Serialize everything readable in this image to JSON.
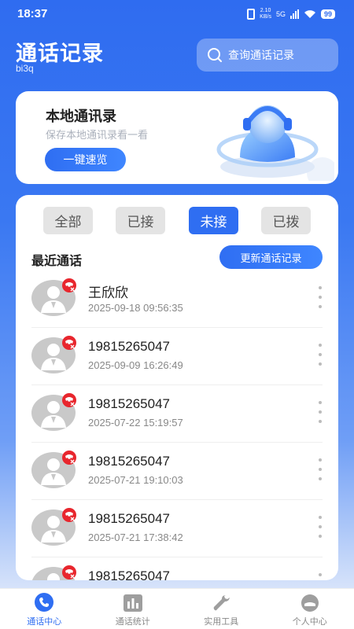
{
  "status_bar": {
    "time": "18:37",
    "speed_top": "2.10",
    "speed_bottom": "KB/s",
    "network": "5G",
    "battery": "99"
  },
  "header": {
    "title": "通话记录",
    "subtitle": "bi3q",
    "search_placeholder": "查询通话记录"
  },
  "local_card": {
    "title": "本地通讯录",
    "description": "保存本地通讯录看一看",
    "button": "一键速览"
  },
  "tabs": [
    {
      "label": "全部",
      "active": false
    },
    {
      "label": "已接",
      "active": false
    },
    {
      "label": "未接",
      "active": true
    },
    {
      "label": "已拨",
      "active": false
    }
  ],
  "recent": {
    "title": "最近通话",
    "update_button": "更新通话记录"
  },
  "calls": [
    {
      "name": "王欣欣",
      "time": "2025-09-18 09:56:35"
    },
    {
      "name": "19815265047",
      "time": "2025-09-09 16:26:49"
    },
    {
      "name": "19815265047",
      "time": "2025-07-22 15:19:57"
    },
    {
      "name": "19815265047",
      "time": "2025-07-21 19:10:03"
    },
    {
      "name": "19815265047",
      "time": "2025-07-21 17:38:42"
    },
    {
      "name": "19815265047",
      "time": ""
    }
  ],
  "nav": [
    {
      "label": "通话中心",
      "icon": "phone-icon",
      "active": true
    },
    {
      "label": "通话统计",
      "icon": "bar-chart-icon",
      "active": false
    },
    {
      "label": "实用工具",
      "icon": "wrench-icon",
      "active": false
    },
    {
      "label": "个人中心",
      "icon": "user-icon",
      "active": false
    }
  ],
  "colors": {
    "primary": "#2f6ef2",
    "missed": "#e8262d",
    "tab_inactive": "#e4e4e4"
  }
}
